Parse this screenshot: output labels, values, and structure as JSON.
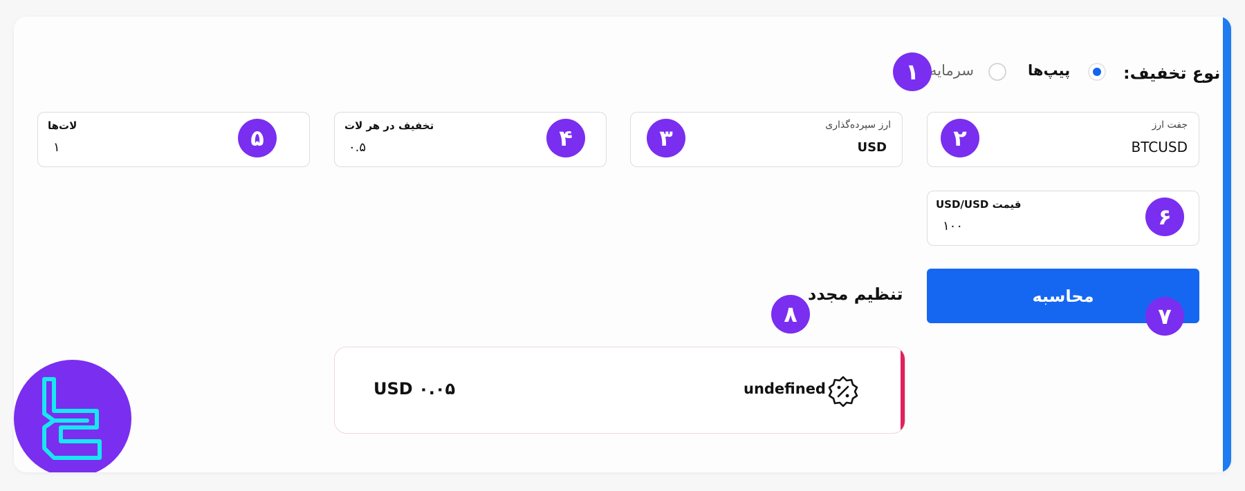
{
  "discount_type": {
    "label": "نوع تخفیف:",
    "options": [
      {
        "label": "پیپ‌ها",
        "selected": true
      },
      {
        "label": "سرمایه",
        "selected": false
      }
    ]
  },
  "fields": {
    "currency_pair": {
      "label": "جفت ارز",
      "value": "BTCUSD"
    },
    "deposit_currency": {
      "label": "ارز سپرده‌گذاری",
      "value": "USD"
    },
    "discount_per_lot": {
      "label": "تخفیف در هر لات",
      "value": "۰.۵"
    },
    "lots": {
      "label": "لات‌ها",
      "value": "۱"
    },
    "price": {
      "label": "قیمت USD/USD",
      "value": "۱۰۰"
    }
  },
  "calculate_button": "محاسبه",
  "reset_button": "تنظیم مجدد",
  "result": {
    "description": "undefined",
    "amount": "۰.۰۵ USD",
    "icon": "discount-badge-icon"
  },
  "badges": [
    "۱",
    "۲",
    "۳",
    "۴",
    "۵",
    "۶",
    "۷",
    "۸"
  ],
  "logo": {
    "name": "tradingfinder-logo"
  },
  "colors": {
    "accent": "#1e7bf0",
    "button": "#1567f2",
    "badge": "#7a2ef0",
    "result_bar": "#e0215c",
    "logo_stroke": "#19e6f0"
  }
}
